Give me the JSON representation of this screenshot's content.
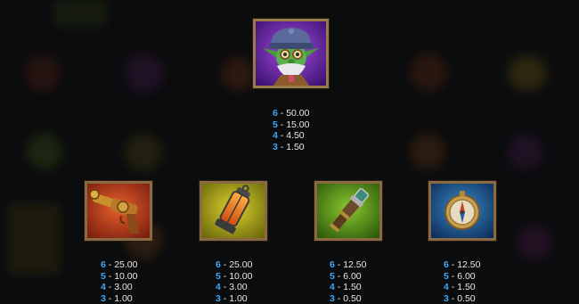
{
  "main_symbol": {
    "icon": "goblin-icon",
    "payouts": [
      {
        "count": "6",
        "value": "50.00"
      },
      {
        "count": "5",
        "value": "15.00"
      },
      {
        "count": "4",
        "value": "4.50"
      },
      {
        "count": "3",
        "value": "1.50"
      }
    ]
  },
  "symbols": [
    {
      "icon": "ray-gun-icon",
      "payouts": [
        {
          "count": "6",
          "value": "25.00"
        },
        {
          "count": "5",
          "value": "10.00"
        },
        {
          "count": "4",
          "value": "3.00"
        },
        {
          "count": "3",
          "value": "1.00"
        }
      ]
    },
    {
      "icon": "lantern-icon",
      "payouts": [
        {
          "count": "6",
          "value": "25.00"
        },
        {
          "count": "5",
          "value": "10.00"
        },
        {
          "count": "4",
          "value": "3.00"
        },
        {
          "count": "3",
          "value": "1.00"
        }
      ]
    },
    {
      "icon": "spyglass-icon",
      "payouts": [
        {
          "count": "6",
          "value": "12.50"
        },
        {
          "count": "5",
          "value": "6.00"
        },
        {
          "count": "4",
          "value": "1.50"
        },
        {
          "count": "3",
          "value": "0.50"
        }
      ]
    },
    {
      "icon": "compass-icon",
      "payouts": [
        {
          "count": "6",
          "value": "12.50"
        },
        {
          "count": "5",
          "value": "6.00"
        },
        {
          "count": "4",
          "value": "1.50"
        },
        {
          "count": "3",
          "value": "0.50"
        }
      ]
    }
  ],
  "separator": "-",
  "colors": {
    "count": "#3fa7f5",
    "value": "#e8e8e8",
    "frame": "#8a6a45",
    "background": "#0b0c0d"
  }
}
